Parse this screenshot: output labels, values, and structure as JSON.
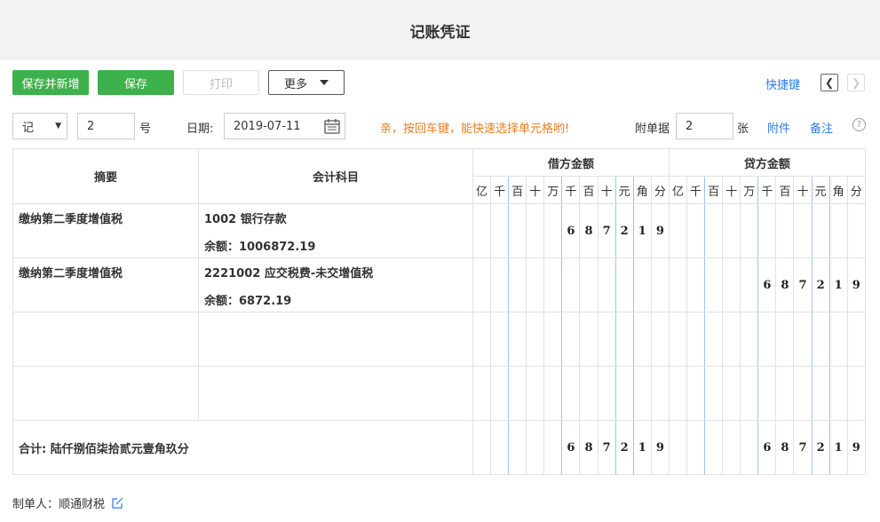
{
  "header": {
    "title": "记账凭证"
  },
  "toolbar": {
    "save_new": "保存并新增",
    "save": "保存",
    "print": "打印",
    "more": "更多",
    "shortcuts": "快捷键"
  },
  "meta": {
    "voucher_word": "记",
    "voucher_no": "2",
    "no_suffix": "号",
    "date_label": "日期:",
    "date_value": "2019-07-11",
    "tip": "亲，按回车键，能快速选择单元格哟!",
    "attach_label": "附单据",
    "attach_count": "2",
    "attach_unit": "张",
    "attachments": "附件",
    "notes": "备注",
    "help": "?"
  },
  "table": {
    "col_summary": "摘要",
    "col_account": "会计科目",
    "col_debit": "借方金额",
    "col_credit": "贷方金额",
    "digits": [
      "亿",
      "千",
      "百",
      "十",
      "万",
      "千",
      "百",
      "十",
      "元",
      "角",
      "分"
    ],
    "rows": [
      {
        "summary": "缴纳第二季度增值税",
        "account": "1002 银行存款",
        "balance_label": "余额：",
        "balance": "1006872.19",
        "debit": [
          "",
          "",
          "",
          "",
          "",
          "6",
          "8",
          "7",
          "2",
          "1",
          "9"
        ],
        "credit": [
          "",
          "",
          "",
          "",
          "",
          "",
          "",
          "",
          "",
          "",
          ""
        ]
      },
      {
        "summary": "缴纳第二季度增值税",
        "account": "2221002 应交税费-未交增值税",
        "balance_label": "余额：",
        "balance": "6872.19",
        "debit": [
          "",
          "",
          "",
          "",
          "",
          "",
          "",
          "",
          "",
          "",
          ""
        ],
        "credit": [
          "",
          "",
          "",
          "",
          "",
          "6",
          "8",
          "7",
          "2",
          "1",
          "9"
        ]
      },
      {
        "summary": "",
        "account": "",
        "balance_label": "",
        "balance": "",
        "debit": [
          "",
          "",
          "",
          "",
          "",
          "",
          "",
          "",
          "",
          "",
          ""
        ],
        "credit": [
          "",
          "",
          "",
          "",
          "",
          "",
          "",
          "",
          "",
          "",
          ""
        ]
      },
      {
        "summary": "",
        "account": "",
        "balance_label": "",
        "balance": "",
        "debit": [
          "",
          "",
          "",
          "",
          "",
          "",
          "",
          "",
          "",
          "",
          ""
        ],
        "credit": [
          "",
          "",
          "",
          "",
          "",
          "",
          "",
          "",
          "",
          "",
          ""
        ]
      }
    ],
    "total_label": "合计: 陆仟捌佰柒拾贰元壹角玖分",
    "total_debit": [
      "",
      "",
      "",
      "",
      "",
      "6",
      "8",
      "7",
      "2",
      "1",
      "9"
    ],
    "total_credit": [
      "",
      "",
      "",
      "",
      "",
      "6",
      "8",
      "7",
      "2",
      "1",
      "9"
    ]
  },
  "footer": {
    "maker_label": "制单人：",
    "maker": "顺通财税"
  },
  "colors": {
    "green": "#3db14b",
    "link": "#2c7be5",
    "tip": "#e67e22"
  }
}
